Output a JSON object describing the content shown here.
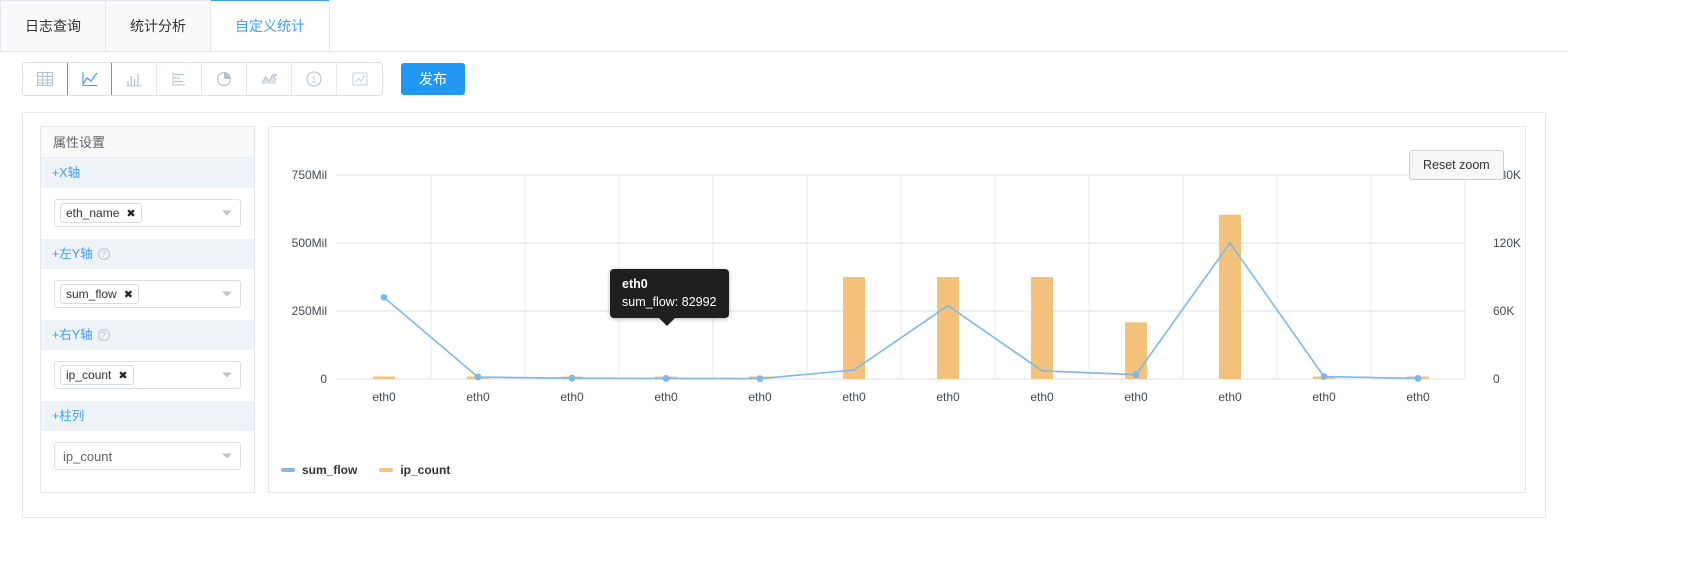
{
  "tabs": [
    {
      "label": "日志查询",
      "active": false
    },
    {
      "label": "统计分析",
      "active": false
    },
    {
      "label": "自定义统计",
      "active": true
    }
  ],
  "toolbar": {
    "icons": [
      {
        "name": "table-icon",
        "selected": false
      },
      {
        "name": "line-chart-icon",
        "selected": true
      },
      {
        "name": "column-chart-icon",
        "selected": false
      },
      {
        "name": "bar-chart-icon",
        "selected": false
      },
      {
        "name": "pie-chart-icon",
        "selected": false
      },
      {
        "name": "area-chart-icon",
        "selected": false
      },
      {
        "name": "single-value-icon",
        "selected": false
      },
      {
        "name": "map-chart-icon",
        "selected": false
      }
    ],
    "publish_label": "发布"
  },
  "sidebar": {
    "title": "属性设置",
    "sections": [
      {
        "label": "+X轴",
        "help": false,
        "field": {
          "kind": "tag",
          "value": "eth_name",
          "remove": "✖"
        }
      },
      {
        "label": "+左Y轴",
        "help": true,
        "field": {
          "kind": "tag",
          "value": "sum_flow",
          "remove": "✖"
        }
      },
      {
        "label": "+右Y轴",
        "help": true,
        "field": {
          "kind": "tag",
          "value": "ip_count",
          "remove": "✖"
        }
      },
      {
        "label": "+柱列",
        "help": false,
        "field": {
          "kind": "plain",
          "value": "ip_count",
          "remove": ""
        }
      }
    ],
    "help_glyph": "?"
  },
  "chart": {
    "reset_zoom_label": "Reset zoom",
    "tooltip": {
      "title": "eth0",
      "value": "sum_flow: 82992"
    }
  },
  "chart_data": {
    "type": "line",
    "title": "",
    "xlabel": "",
    "ylabel": "",
    "grid": true,
    "legend_position": "bottom-left",
    "categories": [
      "eth0",
      "eth0",
      "eth0",
      "eth0",
      "eth0",
      "eth0",
      "eth0",
      "eth0",
      "eth0",
      "eth0",
      "eth0",
      "eth0"
    ],
    "axes": {
      "left": {
        "name": "sum_flow",
        "ticks": [
          "0",
          "250Mil",
          "500Mil",
          "750Mil"
        ],
        "tick_values": [
          0,
          250000000,
          500000000,
          750000000
        ],
        "ylim": [
          0,
          750000000
        ]
      },
      "right": {
        "name": "ip_count",
        "ticks": [
          "0",
          "60K",
          "120K",
          "180K"
        ],
        "tick_values": [
          0,
          60000,
          120000,
          180000
        ],
        "ylim": [
          0,
          180000
        ]
      }
    },
    "series": [
      {
        "name": "sum_flow",
        "type": "line",
        "axis": "left",
        "color": "#7cb9e8",
        "values": [
          300000000,
          7000000,
          3000000,
          2000000,
          1500000,
          33000000,
          270000000,
          30000000,
          16000000,
          500000000,
          9000000,
          2000000
        ]
      },
      {
        "name": "ip_count",
        "type": "column",
        "axis": "right",
        "color": "#f5c27d",
        "values": [
          1200,
          1400,
          1300,
          1200,
          1100,
          90000,
          90000,
          90000,
          50000,
          145000,
          1500,
          900
        ]
      }
    ]
  }
}
